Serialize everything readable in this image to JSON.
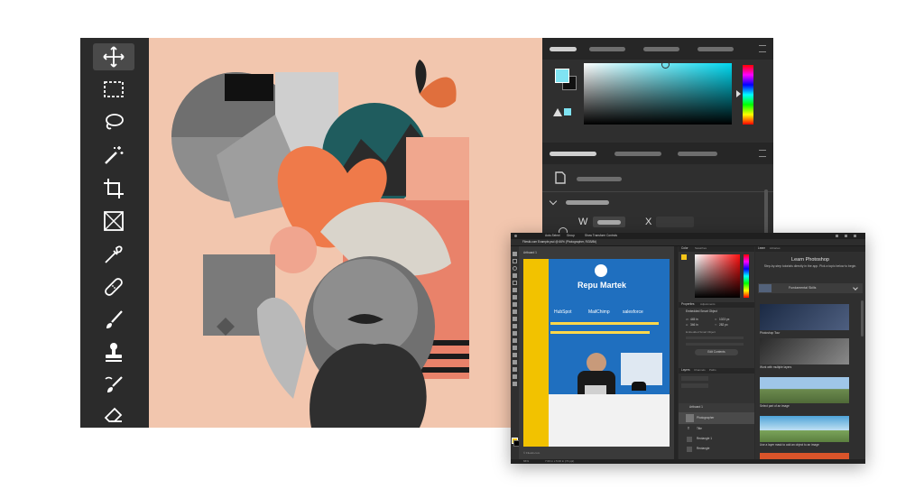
{
  "big_window": {
    "tools": [
      {
        "name": "move-tool-icon"
      },
      {
        "name": "marquee-tool-icon"
      },
      {
        "name": "lasso-tool-icon"
      },
      {
        "name": "magic-wand-tool-icon"
      },
      {
        "name": "crop-tool-icon"
      },
      {
        "name": "frame-tool-icon"
      },
      {
        "name": "eyedropper-tool-icon"
      },
      {
        "name": "healing-brush-tool-icon"
      },
      {
        "name": "brush-tool-icon"
      },
      {
        "name": "clone-stamp-tool-icon"
      },
      {
        "name": "history-brush-tool-icon"
      },
      {
        "name": "eraser-tool-icon"
      }
    ],
    "properties": {
      "w_label": "W",
      "x_label": "X"
    },
    "colors": {
      "foreground": "#7fe3f2",
      "background": "#111111",
      "canvas_bg": "#f2c6ae",
      "panel": "#2f2f2f"
    }
  },
  "small_window": {
    "tab_title": "Filestk.com Example.psd @ 66% (Photographer, RGB/8#)",
    "artboard_label": "Artboard 1",
    "menu": [
      "Auto-Select",
      "Group",
      "Show Transform Controls"
    ],
    "canvas": {
      "brand": "Repu Martek",
      "partners": [
        "HubSpot",
        "MailChimp",
        "salesforce"
      ],
      "footer_text": "© Filestk.com"
    },
    "color_tabs": [
      "Color",
      "Swatches"
    ],
    "properties_tabs": [
      "Properties",
      "Adjustments"
    ],
    "properties": {
      "layer_type": "Embedded Smart Object",
      "w_label": "W:",
      "w_value": "445 in",
      "x_label": "X:",
      "x_value": "1023 px",
      "h_label": "H:",
      "h_value": "346 in",
      "y_label": "Y:",
      "y_value": "282 px",
      "filter_text": "Embedded Smart Object",
      "edit_button": "Edit Contents"
    },
    "layers_tabs": [
      "Layers",
      "Channels",
      "Paths"
    ],
    "layers": [
      "Artboard 1",
      "Photographer",
      "Title",
      "Rectangle 1",
      "Rectangle"
    ],
    "learn": {
      "tabs": [
        "Learn",
        "Libraries"
      ],
      "title": "Learn Photoshop",
      "subtitle": "Step-by-step tutorials directly in the app. Pick a topic below to begin.",
      "section": "Fundamental Skills",
      "items": [
        "Photoshop Tour",
        "Work with multiple layers",
        "Select part of an image",
        "Use a layer mask to add an object to an image"
      ]
    },
    "status": [
      "66%",
      "7.00 in x 5.00 in (72 ppi)"
    ]
  }
}
